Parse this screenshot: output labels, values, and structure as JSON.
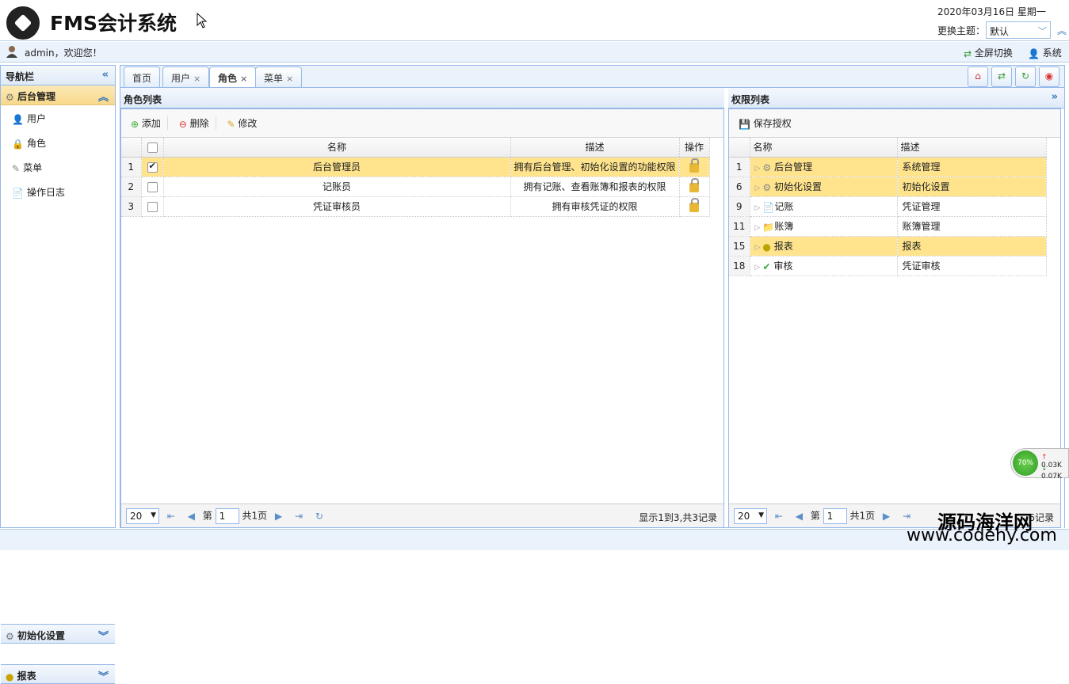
{
  "app": {
    "title": "FMS会计系统",
    "date": "2020年03月16日 星期一",
    "theme_label": "更换主题：",
    "theme_value": "默认"
  },
  "userbar": {
    "welcome": "admin，欢迎您！",
    "fullscreen": "全屏切换",
    "system": "系统"
  },
  "sidebar": {
    "header": "导航栏",
    "groups": [
      {
        "label": "后台管理"
      },
      {
        "label": "初始化设置"
      },
      {
        "label": "报表"
      }
    ],
    "items": [
      {
        "label": "用户"
      },
      {
        "label": "角色"
      },
      {
        "label": "菜单"
      },
      {
        "label": "操作日志"
      }
    ]
  },
  "tabs": [
    {
      "label": "首页"
    },
    {
      "label": "用户"
    },
    {
      "label": "角色"
    },
    {
      "label": "菜单"
    }
  ],
  "roles": {
    "title": "角色列表",
    "toolbar": {
      "add": "添加",
      "delete": "删除",
      "edit": "修改"
    },
    "columns": {
      "name": "名称",
      "desc": "描述",
      "op": "操作"
    },
    "rows": [
      {
        "num": "1",
        "name": "后台管理员",
        "desc": "拥有后台管理、初始化设置的功能权限"
      },
      {
        "num": "2",
        "name": "记账员",
        "desc": "拥有记账、查看账簿和报表的权限"
      },
      {
        "num": "3",
        "name": "凭证审核员",
        "desc": "拥有审核凭证的权限"
      }
    ],
    "pager": {
      "size": "20",
      "page_prefix": "第",
      "page": "1",
      "page_suffix": "共1页",
      "info": "显示1到3,共3记录"
    }
  },
  "perms": {
    "title": "权限列表",
    "save": "保存授权",
    "columns": {
      "name": "名称",
      "desc": "描述"
    },
    "rows": [
      {
        "num": "1",
        "name": "后台管理",
        "desc": "系统管理"
      },
      {
        "num": "6",
        "name": "初始化设置",
        "desc": "初始化设置"
      },
      {
        "num": "9",
        "name": "记账",
        "desc": "凭证管理"
      },
      {
        "num": "11",
        "name": "账簿",
        "desc": "账簿管理"
      },
      {
        "num": "15",
        "name": "报表",
        "desc": "报表"
      },
      {
        "num": "18",
        "name": "审核",
        "desc": "凭证审核"
      }
    ],
    "pager": {
      "size": "20",
      "page_prefix": "第",
      "page": "1",
      "page_suffix": "共1页",
      "info": "6记录"
    }
  },
  "speed": {
    "percent": "70%",
    "up": "0.03K",
    "down": "0.07K"
  },
  "watermark": {
    "line1": "源码海洋网",
    "line2": "www.codehy.com"
  }
}
